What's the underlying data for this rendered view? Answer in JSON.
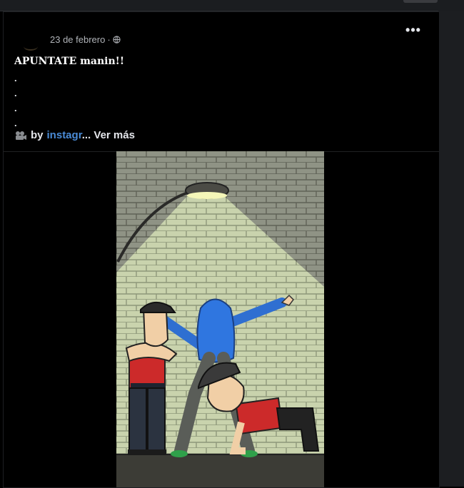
{
  "post": {
    "date": "23 de febrero",
    "separator": "·",
    "title": "APUNTATE manin!!",
    "dots": [
      ".",
      ".",
      ".",
      "."
    ],
    "byline_prefix": "by",
    "link_text": "instagr",
    "ellipsis": "...",
    "see_more": "Ver más"
  },
  "icons": {
    "privacy": "globe-icon",
    "more": "more-options-icon",
    "video": "video-camera-icon"
  },
  "colors": {
    "background": "#000000",
    "meta_text": "#b0b3b8",
    "link": "#4a8bd6",
    "text": "#e4e6eb"
  }
}
